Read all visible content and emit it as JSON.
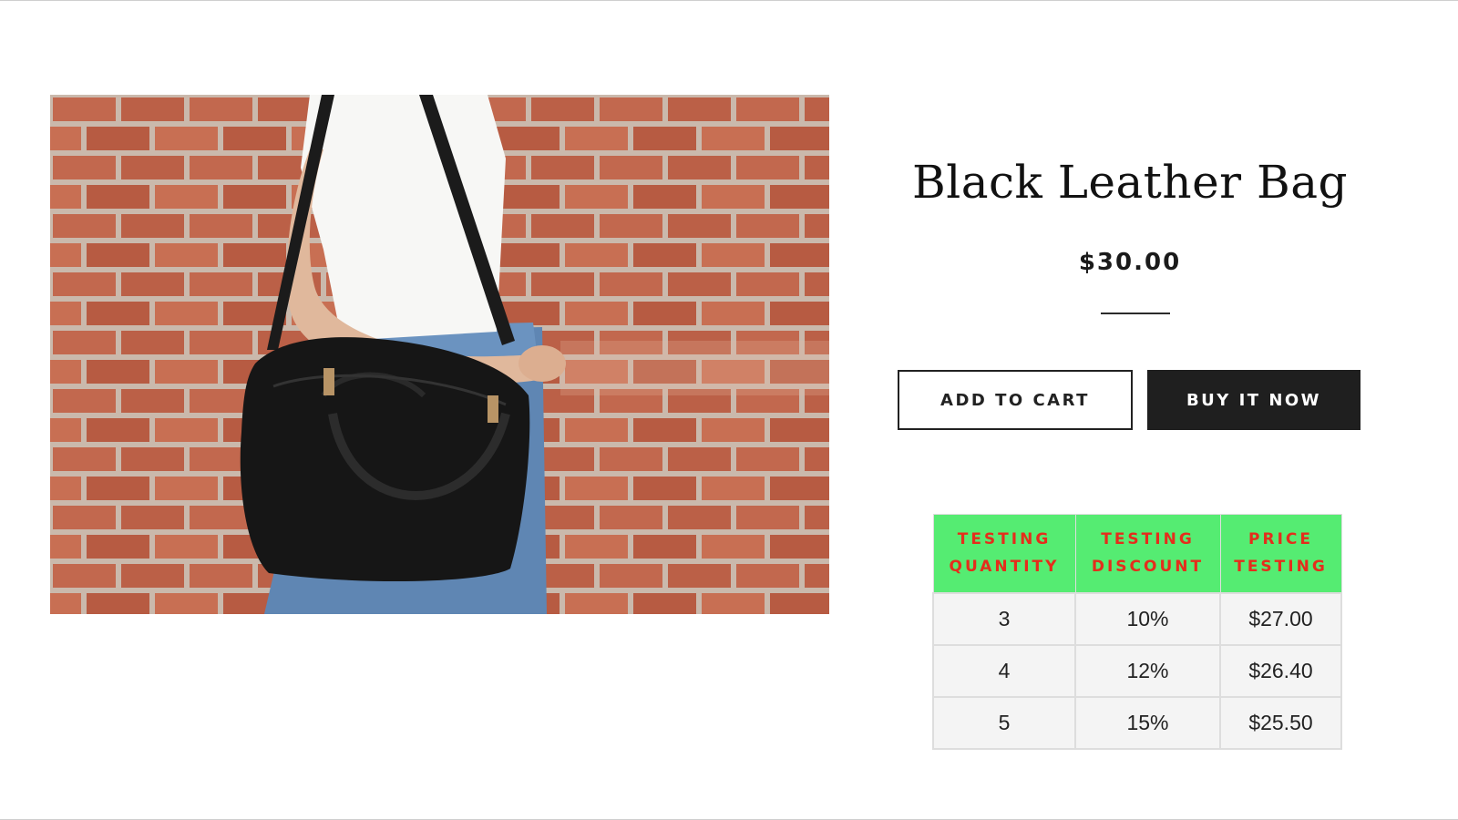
{
  "product": {
    "title": "Black Leather Bag",
    "price": "$30.00",
    "image_description_icon": "product-photo"
  },
  "buttons": {
    "add_to_cart": "ADD TO CART",
    "buy_now": "BUY IT NOW"
  },
  "discount_table": {
    "headers": [
      {
        "line1": "TESTING",
        "line2": "QUANTITY"
      },
      {
        "line1": "TESTING",
        "line2": "DISCOUNT"
      },
      {
        "line1": "PRICE",
        "line2": "TESTING"
      }
    ],
    "rows": [
      {
        "quantity": "3",
        "discount": "10%",
        "price": "$27.00"
      },
      {
        "quantity": "4",
        "discount": "12%",
        "price": "$26.40"
      },
      {
        "quantity": "5",
        "discount": "15%",
        "price": "$25.50"
      }
    ]
  },
  "colors": {
    "header_bg": "#55ec72",
    "header_text": "#e52d1c",
    "buy_button_bg": "#1f1f1f"
  }
}
